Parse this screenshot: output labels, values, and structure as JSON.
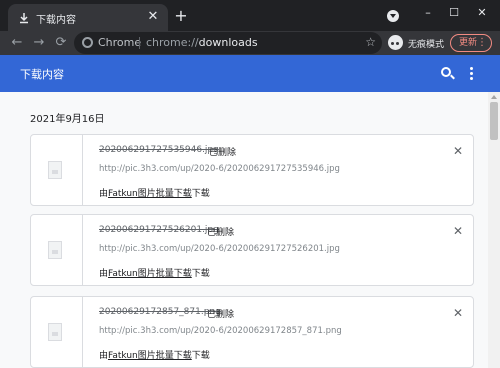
{
  "tab": {
    "title": "下载内容",
    "close": "✕",
    "new": "+"
  },
  "window": {
    "minimize": "–",
    "maximize": "☐",
    "close": "✕"
  },
  "toolbar": {
    "back": "←",
    "forward": "→",
    "reload": "⟳",
    "omnibox": {
      "site_label": "Chrome",
      "scheme": "chrome://",
      "host": "downloads"
    },
    "star": "☆",
    "incognito_label": "无痕模式",
    "update_label": "更新",
    "more": "⋮"
  },
  "app": {
    "title": "下载内容"
  },
  "downloads": {
    "date": "2021年9月16日",
    "items": [
      {
        "name": "202006291727535946.jpg",
        "status": "已删除",
        "url": "http://pic.3h3.com/up/2020-6/202006291727535946.jpg",
        "by_prefix": "由",
        "by_link": "Fatkun图片批量下载",
        "by_suffix": "下载"
      },
      {
        "name": "20200629172752620​1.jpg",
        "status": "已删除",
        "url": "http://pic.3h3.com/up/2020-6/202006291727526201.jpg",
        "by_prefix": "由",
        "by_link": "Fatkun图片批量下载",
        "by_suffix": "下载"
      },
      {
        "name": "20200629172857_871.png",
        "status": "已删除",
        "url": "http://pic.3h3.com/up/2020-6/20200629172857_871.png",
        "by_prefix": "由",
        "by_link": "Fatkun图片批量下载",
        "by_suffix": "下载"
      }
    ]
  },
  "colors": {
    "accent": "#3367d6",
    "update": "#f28b82"
  }
}
